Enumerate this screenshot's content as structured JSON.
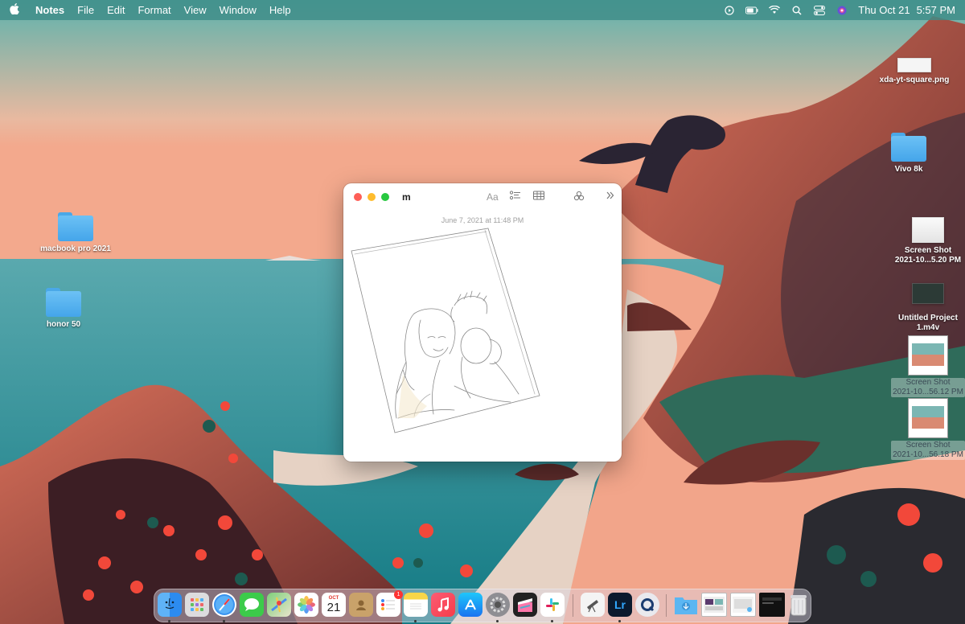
{
  "menubar": {
    "app_name": "Notes",
    "menus": [
      "File",
      "Edit",
      "Format",
      "View",
      "Window",
      "Help"
    ],
    "icons": [
      "apple-icon",
      "play-icon",
      "battery-icon",
      "wifi-icon",
      "spotlight-icon",
      "control-center-icon",
      "siri-icon"
    ],
    "date": "Thu Oct 21",
    "time": "5:57 PM"
  },
  "desktop": {
    "left_items": [
      {
        "label": "macbook pro 2021",
        "type": "folder"
      },
      {
        "label": "honor  50",
        "type": "folder"
      }
    ],
    "right_items": [
      {
        "label": "xda-yt-square.png",
        "type": "image"
      },
      {
        "label": "Vivo 8k",
        "type": "folder"
      },
      {
        "label_line1": "Screen Shot",
        "label_line2": "2021-10...5.20 PM",
        "type": "screenshot"
      },
      {
        "label_line1": "Untitled Project",
        "label_line2": "1.m4v",
        "type": "video"
      },
      {
        "label_line1": "Screen Shot",
        "label_line2": "2021-10...56.12 PM",
        "type": "screenshot"
      },
      {
        "label_line1": "Screen Shot",
        "label_line2": "2021-10...56.18 PM",
        "type": "screenshot"
      }
    ]
  },
  "notes_window": {
    "title": "m",
    "toolbar": {
      "format_label": "Aa",
      "icons": [
        "checklist-icon",
        "table-icon",
        "share-collaborate-icon",
        "chevron-more-icon"
      ]
    },
    "note_date": "June 7, 2021 at 11:48 PM"
  },
  "dock": {
    "apps": [
      "Finder",
      "Launchpad",
      "Safari",
      "Messages",
      "Maps",
      "Photos",
      "Calendar",
      "Contacts",
      "Reminders",
      "Notes",
      "Music",
      "App Store",
      "System Preferences",
      "Final Cut Pro",
      "Slack",
      "Pixelmator",
      "Lightroom",
      "QuickTime Player",
      "Downloads",
      "Screenshot Stack",
      "Trash"
    ],
    "calendar_month": "OCT",
    "calendar_day": "21",
    "reminders_badge": "1",
    "lightroom_label": "Lr"
  },
  "colors": {
    "accent_folder": "#5bb6f2",
    "close": "#fe5f57",
    "minimize": "#febc2e",
    "zoom": "#28c840"
  }
}
